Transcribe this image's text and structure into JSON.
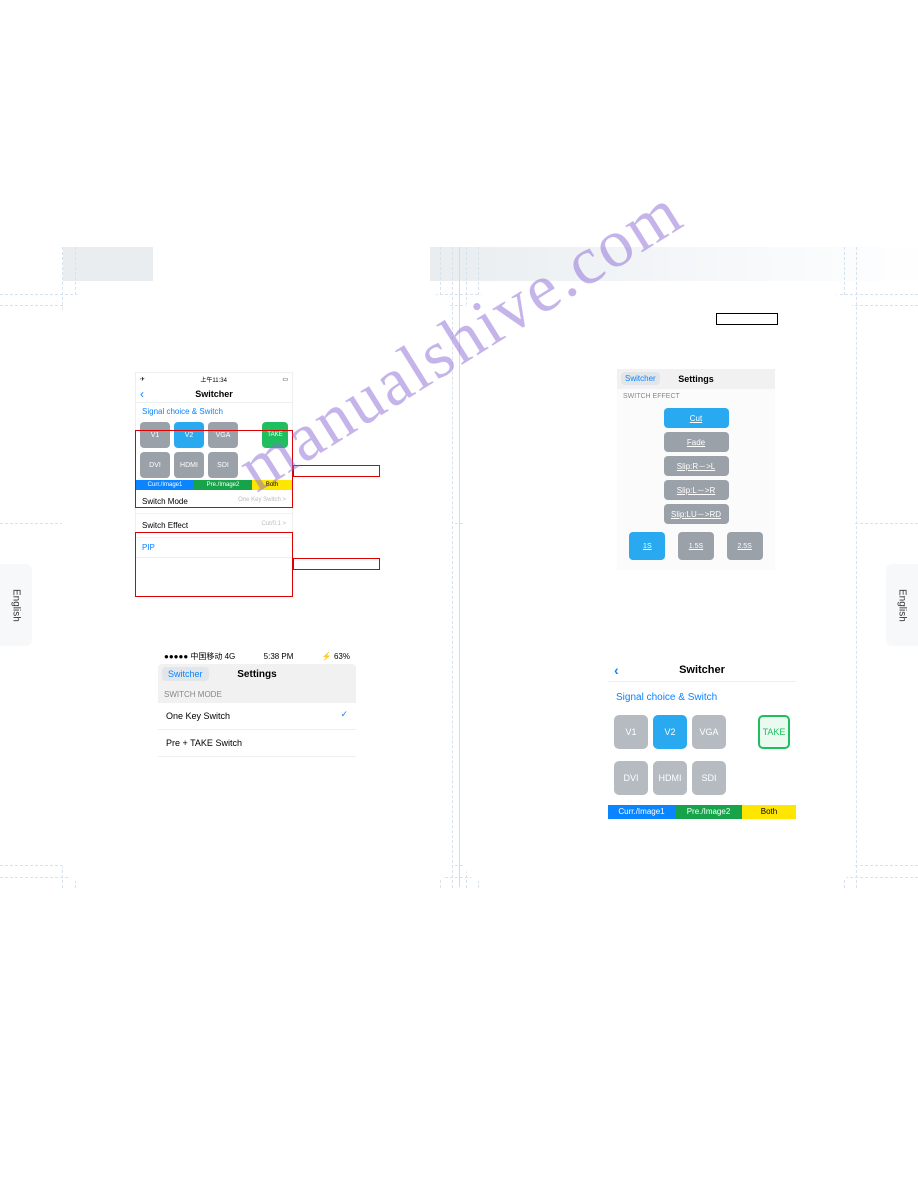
{
  "watermark": "manualshive.com",
  "side_tab_left": "English",
  "side_tab_right": "English",
  "shot1": {
    "time": "上午11:34",
    "title": "Switcher",
    "section": "Signal choice & Switch",
    "signals1": {
      "v1": "V1",
      "v2": "V2",
      "vga": "VGA",
      "take": "TAKE"
    },
    "signals2": {
      "dvi": "DVI",
      "hdmi": "HDMI",
      "sdi": "SDI"
    },
    "tags": {
      "cur": "Curr./Image1",
      "pre": "Pre./Image2",
      "both": "Both"
    },
    "row1_label": "Switch Mode",
    "row1_val": "One Key Switch  >",
    "row2_label": "Switch Effect",
    "row2_val": "Cut/0.1  >",
    "pip": "PIP"
  },
  "shot2": {
    "carrier": "●●●●● 中国移动 4G",
    "time": "5:38 PM",
    "battery": "63%",
    "back": "Switcher",
    "title": "Settings",
    "section": "SWITCH MODE",
    "opt1": "One Key Switch",
    "opt2": "Pre + TAKE Switch"
  },
  "shot3": {
    "back": "Switcher",
    "title": "Settings",
    "section": "SWITCH EFFECT",
    "effects": {
      "cut": "Cut",
      "fade": "Fade",
      "rl": "Slip:R－>L",
      "lr": "Slip:L－>R",
      "lurd": "Slip:LU－>RD"
    },
    "speeds": {
      "s1": "1S",
      "s15": "1.5S",
      "s25": "2.5S"
    }
  },
  "shot4": {
    "title": "Switcher",
    "section": "Signal choice & Switch",
    "signals1": {
      "v1": "V1",
      "v2": "V2",
      "vga": "VGA",
      "take": "TAKE"
    },
    "signals2": {
      "dvi": "DVI",
      "hdmi": "HDMI",
      "sdi": "SDI"
    },
    "tags": {
      "cur": "Curr./Image1",
      "pre": "Pre./Image2",
      "both": "Both"
    }
  }
}
